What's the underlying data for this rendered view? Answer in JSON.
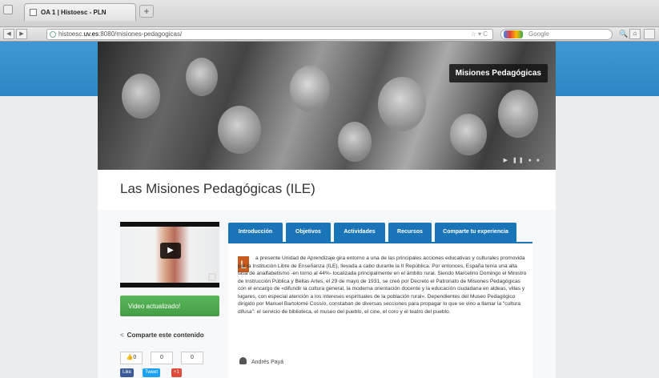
{
  "browser": {
    "tab_title": "OA 1 | Histoesc - PLN",
    "new_tab": "+",
    "url_prefix": "histoesc.",
    "url_domain": "uv.es",
    "url_rest": ":8080/misiones-pedagogicas/",
    "url_icons": "☆ ▾ C",
    "search_placeholder": "Google",
    "back": "◀",
    "forward": "▶",
    "search_icon": "🔍",
    "home_icon": "⌂"
  },
  "hero": {
    "title": "Misiones Pedagógicas",
    "slider_dots": "▶ ❚❚ ● ●"
  },
  "page": {
    "title": "Las Misiones Pedagógicas (ILE)"
  },
  "sidebar": {
    "video_play": "▶",
    "video_updated": "Video actualizado!",
    "share_label": "Comparte este contenido",
    "share_icon": "<",
    "counts": [
      "👍0",
      "0",
      "0"
    ],
    "social": [
      "Like",
      "Tweet",
      "+1"
    ]
  },
  "tabs": [
    "Introducción",
    "Objetivos",
    "Actividades",
    "Recursos",
    "Comparte tu experiencia"
  ],
  "content": {
    "dropcap": "L",
    "paragraph": "a presente Unidad de Aprendizaje gira entorno a una de las principales acciones educativas y culturales promovida por la Institución Libre de Enseñanza (ILE), llevada a cabo durante la II República. Por entonces, España tenía una alta tasa de analfabetismo -en torno al 44%- localizada principalmente en el ámbito rural. Siendo Marcelino Domingo el Ministro de Instrucción Pública y Bellas Artes, el 29 de mayo de 1931, se creó por Decreto el Patronato de Misiones Pedagógicas con el encargo de «difundir la cultura general, la moderna orientación docente y la educación ciudadana en aldeas, villas y lugares, con especial atención a los intereses espirituales de la población rural». Dependientes del Museo Pedagógico dirigido por Manuel Bartolomé Cossío, constaban de diversas secciones para propagar lo que se vino a llamar la \"cultura difusa\": el servicio de biblioteca, el museo del pueblo, el cine, el coro y el teatro del pueblo.",
    "author": "Andrés Payá"
  },
  "colors": {
    "tab_blue": "#1a75b8",
    "header_blue": "#2f86c6",
    "updated_green": "#5cb85c",
    "dropcap_orange": "#c75b1e"
  }
}
